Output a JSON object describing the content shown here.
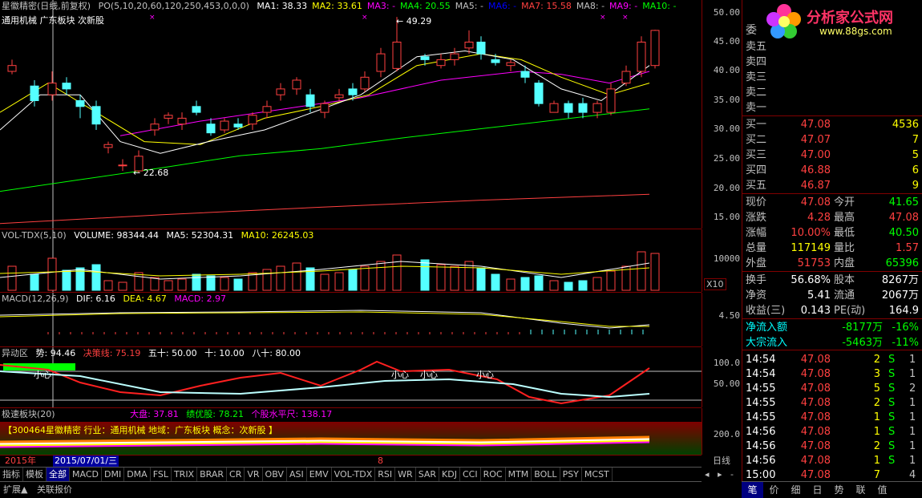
{
  "header": {
    "title": "星徽精密(日线,前复权)",
    "po": "PO(5,10,20,60,120,250,453,0,0,0)",
    "ma": [
      {
        "label": "MA1: 38.33",
        "color": "#ffffff"
      },
      {
        "label": "MA2: 33.61",
        "color": "#ffff00"
      },
      {
        "label": "MA3: -",
        "color": "#ff00ff"
      },
      {
        "label": "MA4: 20.55",
        "color": "#00ff00"
      },
      {
        "label": "MA5: -",
        "color": "#c0c0c0"
      },
      {
        "label": "MA6: -",
        "color": "#0000ff"
      },
      {
        "label": "MA7: 15.58",
        "color": "#ff4040"
      },
      {
        "label": "MA8: -",
        "color": "#c0c0c0"
      },
      {
        "label": "MA9: -",
        "color": "#ff00ff"
      },
      {
        "label": "MA10: -",
        "color": "#00ff00"
      }
    ],
    "sectors": "通用机械 广东板块 次新股",
    "high_marker": "49.29",
    "low_marker": "22.68"
  },
  "price_axis": [
    "50.00",
    "45.00",
    "40.00",
    "35.00",
    "30.00",
    "25.00",
    "20.00",
    "15.00"
  ],
  "vol": {
    "title": "VOL-TDX(5,10)",
    "volume": "VOLUME: 98344.44",
    "ma5": "MA5: 52304.31",
    "ma10": "MA10: 26245.03",
    "axis": "10000",
    "unit": "X10"
  },
  "macd": {
    "title": "MACD(12,26,9)",
    "dif": "DIF: 6.16",
    "dea": "DEA: 4.67",
    "macd": "MACD: 2.97",
    "axis": "4.50"
  },
  "yidong": {
    "title": "异动区",
    "shi": "势: 94.46",
    "jue": "决策线: 75.19",
    "wushi": "五十: 50.00",
    "shi10": "十: 10.00",
    "bashi": "八十: 80.00",
    "axis": [
      "100.0",
      "50.00"
    ],
    "labels": [
      "小心",
      "小心",
      "小心",
      "小心"
    ]
  },
  "jisu": {
    "title": "极速板块(20)",
    "dapan": "大盘: 37.81",
    "jiyou": "绩优股: 78.21",
    "geshu": "个股水平尺: 138.17",
    "info": "【300464星徽精密 行业：通用机械 地域：广东板块 概念：次新股 】",
    "axis": "200.0"
  },
  "dates": {
    "year": "2015年",
    "date": "2015/07/01/三",
    "mark": "8",
    "period": "日线"
  },
  "tabs": [
    "指标",
    "模板",
    "全部",
    "MACD",
    "DMI",
    "DMA",
    "FSL",
    "TRIX",
    "BRAR",
    "CR",
    "VR",
    "OBV",
    "ASI",
    "EMV",
    "VOL-TDX",
    "RSI",
    "WR",
    "SAR",
    "KDJ",
    "CCI",
    "ROC",
    "MTM",
    "BOLL",
    "PSY",
    "MCST"
  ],
  "bottom_tabs": [
    "扩展▲",
    "关联报价"
  ],
  "logo": {
    "text": "分析家公式网",
    "url": "www.88gs.com"
  },
  "order_book": {
    "wb": "委",
    "sell": [
      {
        "label": "卖五",
        "price": "",
        "vol": ""
      },
      {
        "label": "卖四",
        "price": "",
        "vol": ""
      },
      {
        "label": "卖三",
        "price": "",
        "vol": ""
      },
      {
        "label": "卖二",
        "price": "",
        "vol": ""
      },
      {
        "label": "卖一",
        "price": "",
        "vol": ""
      }
    ],
    "buy": [
      {
        "label": "买一",
        "price": "47.08",
        "vol": "4536"
      },
      {
        "label": "买二",
        "price": "47.07",
        "vol": "7"
      },
      {
        "label": "买三",
        "price": "47.00",
        "vol": "5"
      },
      {
        "label": "买四",
        "price": "46.88",
        "vol": "6"
      },
      {
        "label": "买五",
        "price": "46.87",
        "vol": "9"
      }
    ]
  },
  "quote": [
    {
      "l1": "现价",
      "v1": "47.08",
      "c1": "#ff4040",
      "l2": "今开",
      "v2": "41.65",
      "c2": "#00ff00"
    },
    {
      "l1": "涨跌",
      "v1": "4.28",
      "c1": "#ff4040",
      "l2": "最高",
      "v2": "47.08",
      "c2": "#ff4040"
    },
    {
      "l1": "涨幅",
      "v1": "10.00%",
      "c1": "#ff4040",
      "l2": "最低",
      "v2": "40.50",
      "c2": "#00ff00"
    },
    {
      "l1": "总量",
      "v1": "117149",
      "c1": "#ffff00",
      "l2": "量比",
      "v2": "1.57",
      "c2": "#ff4040"
    },
    {
      "l1": "外盘",
      "v1": "51753",
      "c1": "#ff4040",
      "l2": "内盘",
      "v2": "65396",
      "c2": "#00ff00"
    }
  ],
  "fin": [
    {
      "l1": "换手",
      "v1": "56.68%",
      "l2": "股本",
      "v2": "8267万"
    },
    {
      "l1": "净资",
      "v1": "5.41",
      "l2": "流通",
      "v2": "2067万"
    },
    {
      "l1": "收益(三)",
      "v1": "0.143",
      "l2": "PE(动)",
      "v2": "164.9"
    }
  ],
  "flow": [
    {
      "l": "净流入额",
      "v": "-8177万",
      "p": "-16%"
    },
    {
      "l": "大宗流入",
      "v": "-5463万",
      "p": "-11%"
    }
  ],
  "ticks": [
    {
      "t": "14:54",
      "p": "47.08",
      "v": "2",
      "d": "S",
      "n": "1"
    },
    {
      "t": "14:54",
      "p": "47.08",
      "v": "3",
      "d": "S",
      "n": "1"
    },
    {
      "t": "14:55",
      "p": "47.08",
      "v": "5",
      "d": "S",
      "n": "2"
    },
    {
      "t": "14:55",
      "p": "47.08",
      "v": "2",
      "d": "S",
      "n": "1"
    },
    {
      "t": "14:55",
      "p": "47.08",
      "v": "1",
      "d": "S",
      "n": "1"
    },
    {
      "t": "14:56",
      "p": "47.08",
      "v": "1",
      "d": "S",
      "n": "1"
    },
    {
      "t": "14:56",
      "p": "47.08",
      "v": "2",
      "d": "S",
      "n": "1"
    },
    {
      "t": "14:56",
      "p": "47.08",
      "v": "1",
      "d": "S",
      "n": "1"
    },
    {
      "t": "15:00",
      "p": "47.08",
      "v": "7",
      "d": "",
      "n": "4"
    }
  ],
  "right_tabs": [
    "笔",
    "价",
    "细",
    "日",
    "势",
    "联",
    "值"
  ]
}
